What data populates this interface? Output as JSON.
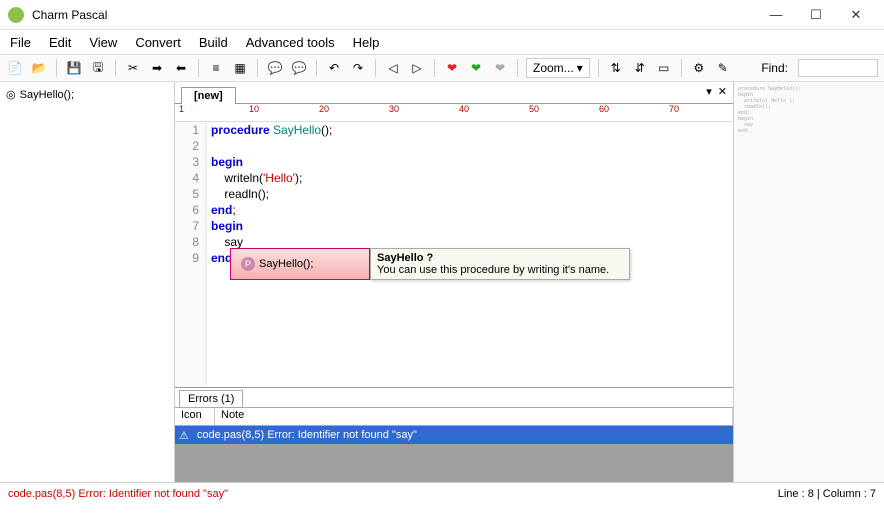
{
  "window": {
    "title": "Charm Pascal"
  },
  "menu": {
    "file": "File",
    "edit": "Edit",
    "view": "View",
    "convert": "Convert",
    "build": "Build",
    "advanced": "Advanced tools",
    "help": "Help"
  },
  "toolbar": {
    "zoom": "Zoom...",
    "find_label": "Find:"
  },
  "sidebar": {
    "items": [
      {
        "label": "SayHello();"
      }
    ]
  },
  "tabs": {
    "active": "[new]"
  },
  "ruler": {
    "marks": [
      "1",
      "10",
      "20",
      "30",
      "40",
      "50",
      "60",
      "70"
    ]
  },
  "code": {
    "lines": [
      {
        "n": 1,
        "tokens": [
          {
            "t": "procedure ",
            "c": "kw"
          },
          {
            "t": "SayHello",
            "c": "fn"
          },
          {
            "t": "();",
            "c": ""
          }
        ]
      },
      {
        "n": 2,
        "tokens": []
      },
      {
        "n": 3,
        "tokens": [
          {
            "t": "begin",
            "c": "kw"
          }
        ]
      },
      {
        "n": 4,
        "tokens": [
          {
            "t": "    writeln(",
            "c": ""
          },
          {
            "t": "'Hello'",
            "c": "str"
          },
          {
            "t": ");",
            "c": ""
          }
        ]
      },
      {
        "n": 5,
        "tokens": [
          {
            "t": "    readln();",
            "c": ""
          }
        ]
      },
      {
        "n": 6,
        "tokens": [
          {
            "t": "end",
            "c": "kw"
          },
          {
            "t": ";",
            "c": ""
          }
        ]
      },
      {
        "n": 7,
        "tokens": [
          {
            "t": "begin",
            "c": "kw"
          }
        ]
      },
      {
        "n": 8,
        "tokens": [
          {
            "t": "    say",
            "c": ""
          }
        ]
      },
      {
        "n": 9,
        "tokens": [
          {
            "t": "end",
            "c": "kw"
          },
          {
            "t": ".",
            "c": ""
          }
        ]
      }
    ]
  },
  "intellisense": {
    "suggestion": "SayHello();",
    "tooltip_title": "SayHello ?",
    "tooltip_body": "You can use this procedure by writing it's name."
  },
  "errors": {
    "tab": "Errors (1)",
    "cols": {
      "icon": "Icon",
      "note": "Note"
    },
    "rows": [
      {
        "note": "code.pas(8,5) Error: Identifier not found \"say\""
      }
    ]
  },
  "status": {
    "error": "code.pas(8,5) Error: Identifier not found \"say\"",
    "pos": "Line : 8 | Column : 7"
  }
}
